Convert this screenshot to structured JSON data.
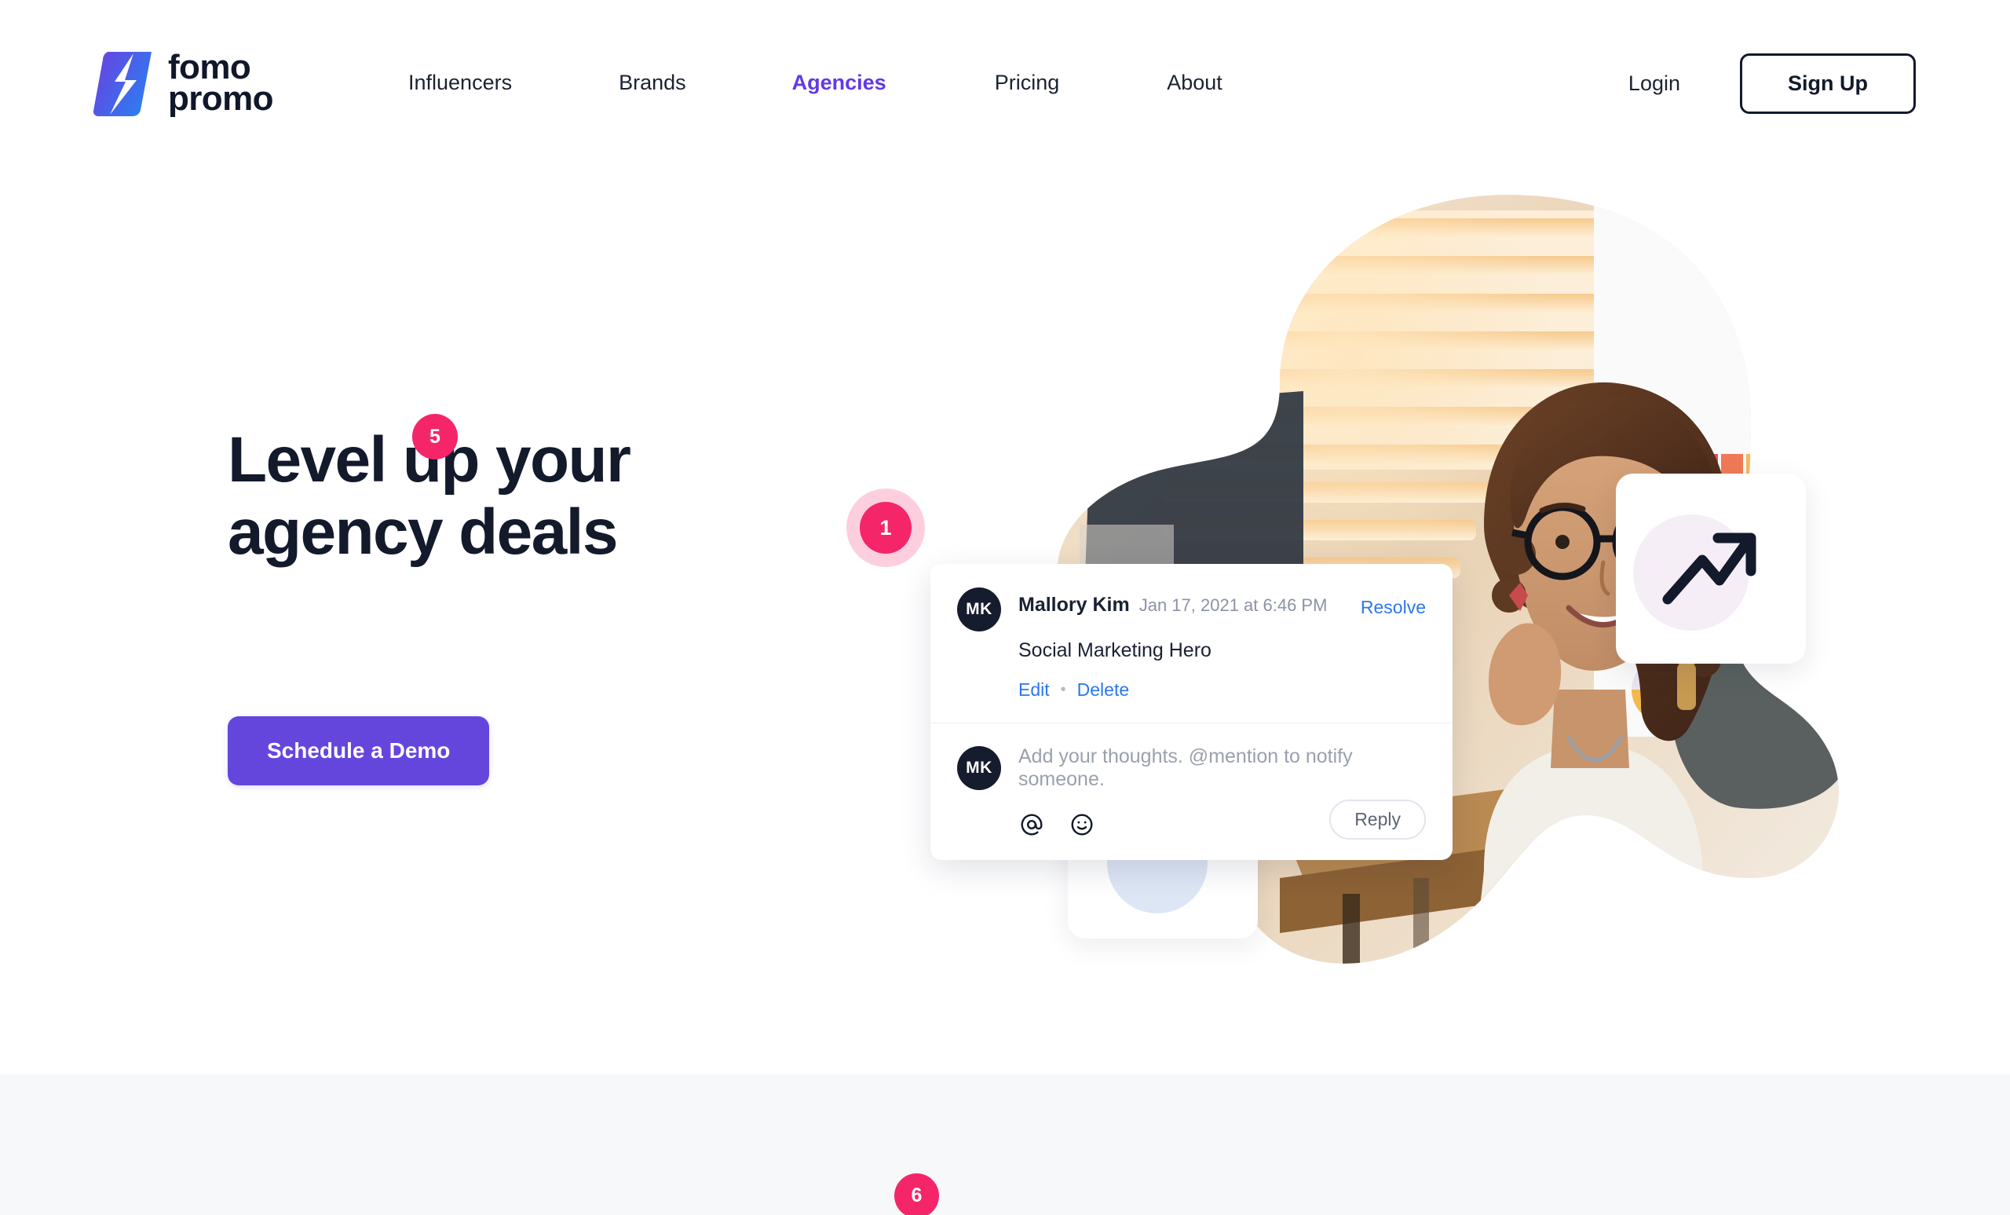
{
  "brand": {
    "name_line1": "fomo",
    "name_line2": "promo",
    "logo_icon": "lightning-bolt-icon",
    "gradient_start": "#6b3fe0",
    "gradient_end": "#2f7bf0"
  },
  "nav": {
    "items": [
      {
        "label": "Influencers",
        "active": false
      },
      {
        "label": "Brands",
        "active": false
      },
      {
        "label": "Agencies",
        "active": true
      },
      {
        "label": "Pricing",
        "active": false
      },
      {
        "label": "About",
        "active": false
      }
    ],
    "active_color": "#6339e8",
    "login_label": "Login",
    "signup_label": "Sign Up"
  },
  "hero": {
    "title_line1": "Level up your",
    "title_line2": "agency deals",
    "cta_label": "Schedule a Demo",
    "cta_color": "#6546dd",
    "image_alt": "Smiling woman with glasses at an office desk"
  },
  "badges": {
    "badge_a": "5",
    "badge_b": "1",
    "badge_c": "6",
    "color": "#f5256a"
  },
  "comment_card": {
    "avatar_initials": "MK",
    "author": "Mallory Kim",
    "timestamp": "Jan 17, 2021 at 6:46 PM",
    "resolve_label": "Resolve",
    "body": "Social Marketing Hero",
    "edit_label": "Edit",
    "separator": "•",
    "delete_label": "Delete",
    "reply_avatar_initials": "MK",
    "reply_placeholder": "Add your thoughts. @mention to notify someone.",
    "mention_icon": "at-sign-icon",
    "emoji_icon": "smiley-face-icon",
    "reply_button_label": "Reply",
    "link_color": "#2b77f0"
  },
  "floating_cards": {
    "chart_icon": "trending-up-arrow-icon",
    "chart_circle_color": "#f5eef6",
    "back_circle_color": "#dde6f5"
  },
  "lower_section": {
    "background": "#f7f8fa"
  }
}
